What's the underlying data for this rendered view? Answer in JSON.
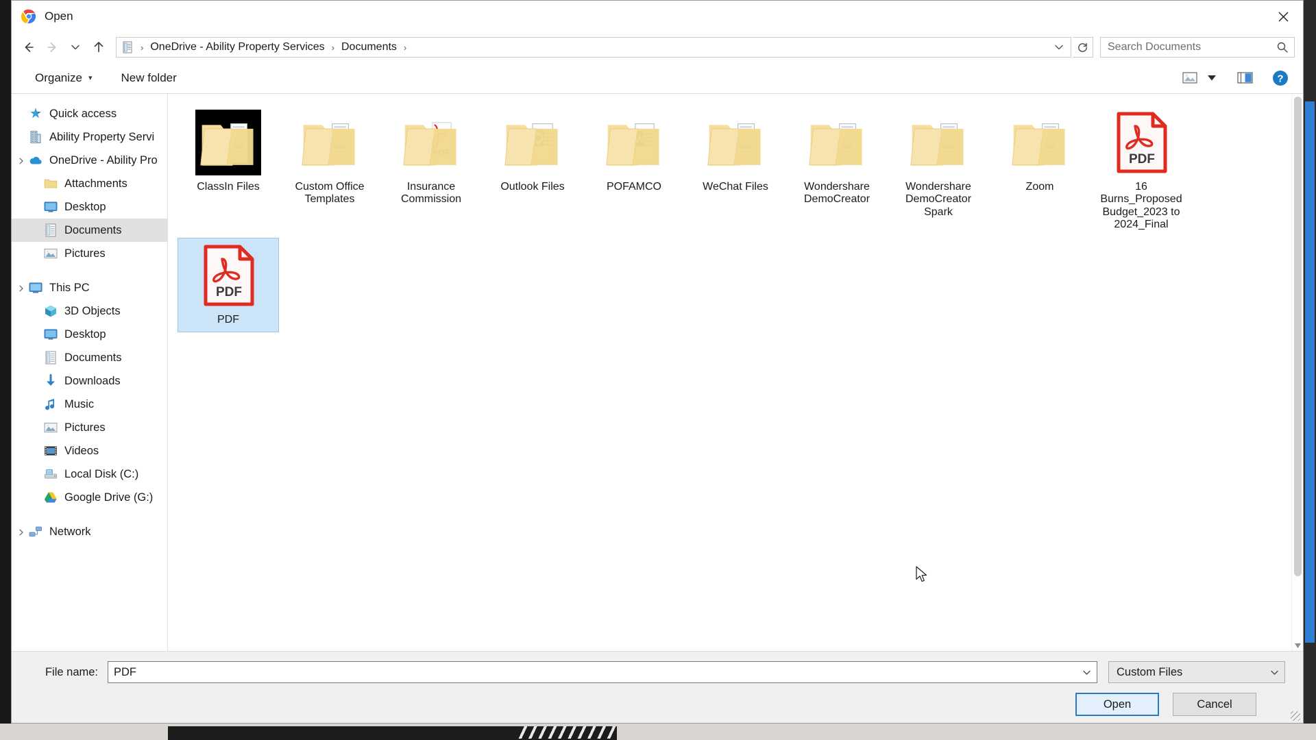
{
  "window": {
    "title": "Open",
    "app_icon": "chrome-icon",
    "close_label": "✕"
  },
  "navigation": {
    "back_icon": "back-arrow-icon",
    "forward_icon": "forward-arrow-icon",
    "history_icon": "chevron-down-icon",
    "up_icon": "up-arrow-icon",
    "refresh_icon": "refresh-icon",
    "breadcrumb_icon": "documents-icon",
    "breadcrumb_dropdown_icon": "chevron-down-icon",
    "crumbs": [
      {
        "label": "OneDrive - Ability Property Services"
      },
      {
        "label": "Documents"
      }
    ],
    "separator": "›"
  },
  "search": {
    "placeholder": "Search Documents",
    "value": "",
    "icon": "search-icon"
  },
  "commandbar": {
    "organize_label": "Organize",
    "organize_caret": "▾",
    "new_folder_label": "New folder",
    "view_icon": "view-thumbnails-icon",
    "view_caret_icon": "caret-down-icon",
    "preview_pane_icon": "preview-pane-icon",
    "help_icon": "help-icon"
  },
  "sidebar": {
    "items": [
      {
        "label": "Quick access",
        "icon": "star-icon",
        "level": 0,
        "selected": false,
        "chevron": false
      },
      {
        "label": "Ability Property Servi",
        "icon": "company-icon",
        "level": 0,
        "selected": false,
        "chevron": false
      },
      {
        "label": "OneDrive - Ability Pro",
        "icon": "onedrive-cloud-icon",
        "level": 0,
        "selected": false,
        "chevron": true
      },
      {
        "label": "Attachments",
        "icon": "folder-icon",
        "level": 1,
        "selected": false,
        "chevron": false
      },
      {
        "label": "Desktop",
        "icon": "desktop-icon",
        "level": 1,
        "selected": false,
        "chevron": false
      },
      {
        "label": "Documents",
        "icon": "documents-icon",
        "level": 1,
        "selected": true,
        "chevron": false
      },
      {
        "label": "Pictures",
        "icon": "pictures-icon",
        "level": 1,
        "selected": false,
        "chevron": false
      },
      {
        "label": "This PC",
        "icon": "this-pc-icon",
        "level": 0,
        "selected": false,
        "chevron": true,
        "gap_before": true
      },
      {
        "label": "3D Objects",
        "icon": "3d-objects-icon",
        "level": 1,
        "selected": false,
        "chevron": false
      },
      {
        "label": "Desktop",
        "icon": "desktop-icon",
        "level": 1,
        "selected": false,
        "chevron": false
      },
      {
        "label": "Documents",
        "icon": "documents-icon",
        "level": 1,
        "selected": false,
        "chevron": false
      },
      {
        "label": "Downloads",
        "icon": "downloads-icon",
        "level": 1,
        "selected": false,
        "chevron": false
      },
      {
        "label": "Music",
        "icon": "music-icon",
        "level": 1,
        "selected": false,
        "chevron": false
      },
      {
        "label": "Pictures",
        "icon": "pictures-icon",
        "level": 1,
        "selected": false,
        "chevron": false
      },
      {
        "label": "Videos",
        "icon": "videos-icon",
        "level": 1,
        "selected": false,
        "chevron": false
      },
      {
        "label": "Local Disk (C:)",
        "icon": "disk-icon",
        "level": 1,
        "selected": false,
        "chevron": false
      },
      {
        "label": "Google Drive (G:)",
        "icon": "google-drive-icon",
        "level": 1,
        "selected": false,
        "chevron": false
      },
      {
        "label": "Network",
        "icon": "network-icon",
        "level": 0,
        "selected": false,
        "chevron": true,
        "gap_before": true
      }
    ]
  },
  "files": {
    "items": [
      {
        "name": "ClassIn Files",
        "type": "folder",
        "thumb": "folder-black-thumb",
        "selected": false
      },
      {
        "name": "Custom Office Templates",
        "type": "folder",
        "thumb": "folder-docs",
        "selected": false
      },
      {
        "name": "Insurance Commission",
        "type": "folder",
        "thumb": "folder-pdf",
        "selected": false
      },
      {
        "name": "Outlook Files",
        "type": "folder",
        "thumb": "folder-outlook",
        "selected": false
      },
      {
        "name": "POFAMCO",
        "type": "folder",
        "thumb": "folder-word",
        "selected": false
      },
      {
        "name": "WeChat Files",
        "type": "folder",
        "thumb": "folder-docs",
        "selected": false
      },
      {
        "name": "Wondershare DemoCreator",
        "type": "folder",
        "thumb": "folder-docs",
        "selected": false
      },
      {
        "name": "Wondershare DemoCreator Spark",
        "type": "folder",
        "thumb": "folder-docs",
        "selected": false
      },
      {
        "name": "Zoom",
        "type": "folder",
        "thumb": "folder-docs",
        "selected": false
      },
      {
        "name": "16 Burns_Proposed Budget_2023 to 2024_Final",
        "type": "pdf",
        "thumb": "pdf-icon",
        "selected": false
      },
      {
        "name": "PDF",
        "type": "pdf",
        "thumb": "pdf-icon",
        "selected": true
      }
    ],
    "pdf_badge_text": "PDF"
  },
  "footer": {
    "filename_label": "File name:",
    "filename_value": "PDF",
    "filename_placeholder": "",
    "filename_caret_icon": "chevron-down-icon",
    "filetype_value": "Custom Files",
    "filetype_caret_icon": "chevron-down-icon",
    "open_label": "Open",
    "cancel_label": "Cancel"
  },
  "colors": {
    "accent": "#2a7ac4",
    "selection": "#cce4f7",
    "folder": "#f6dfa0",
    "pdf_red": "#e02b20",
    "sidebar_selected": "#e0e0e0"
  }
}
